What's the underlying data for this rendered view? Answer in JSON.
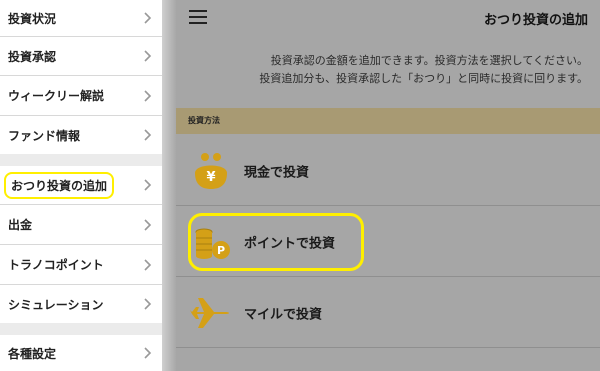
{
  "sidebar": {
    "items": [
      {
        "label": "投資状況"
      },
      {
        "label": "投資承認"
      },
      {
        "label": "ウィークリー解説"
      },
      {
        "label": "ファンド情報"
      },
      {
        "label": "おつり投資の追加"
      },
      {
        "label": "出金"
      },
      {
        "label": "トラノコポイント"
      },
      {
        "label": "シミュレーション"
      },
      {
        "label": "各種設定"
      }
    ]
  },
  "header": {
    "title": "おつり投資の追加"
  },
  "main": {
    "description_line1": "投資承認の金額を追加できます。投資方法を選択してください。",
    "description_line2": "投資追加分も、投資承認した「おつり」と同時に投資に回ります。",
    "section_label": "投資方法",
    "methods": [
      {
        "label": "現金で投資",
        "icon": "coin-purse-icon"
      },
      {
        "label": "ポイントで投資",
        "icon": "point-coins-icon"
      },
      {
        "label": "マイルで投資",
        "icon": "airplane-icon"
      }
    ]
  },
  "colors": {
    "highlight": "#ffef00",
    "icon_gold": "#d4a017",
    "section_header": "#a89a73"
  }
}
